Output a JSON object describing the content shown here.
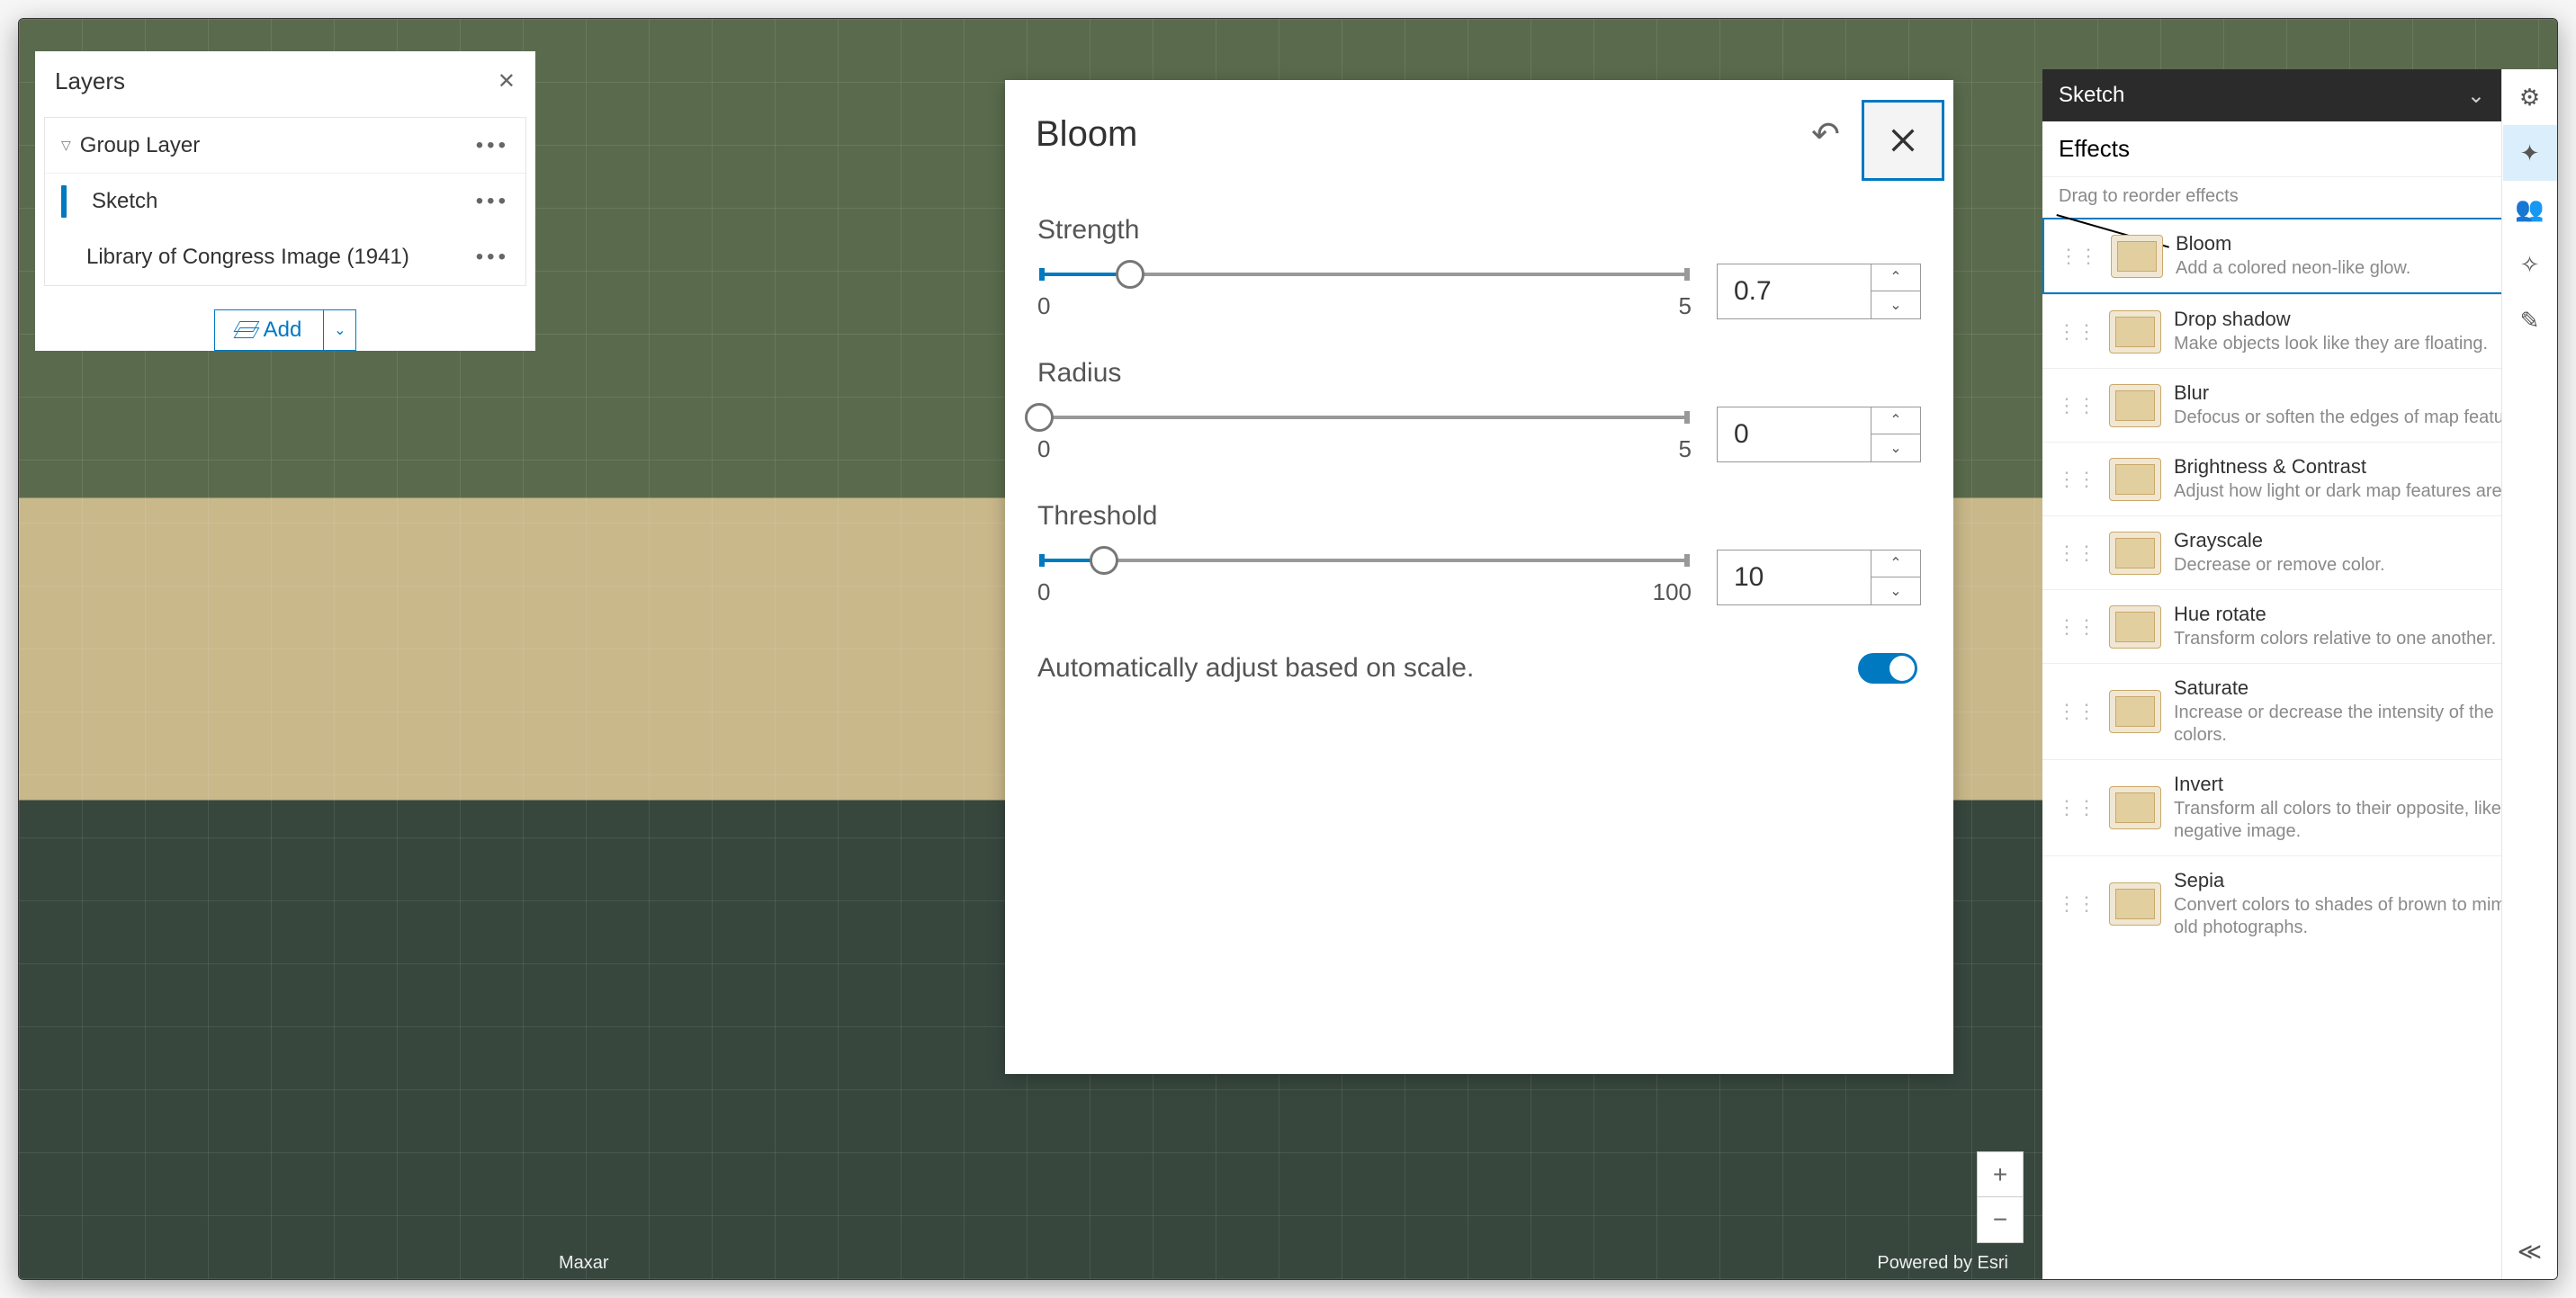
{
  "layers_panel": {
    "title": "Layers",
    "group_label": "Group Layer",
    "items": [
      {
        "name": "Sketch",
        "selected": true
      },
      {
        "name": "Library of Congress Image (1941)",
        "selected": false
      }
    ],
    "add_label": "Add"
  },
  "map": {
    "attrib_left": "Maxar",
    "attrib_right": "Powered by Esri"
  },
  "bloom_dialog": {
    "title": "Bloom",
    "controls": [
      {
        "label": "Strength",
        "min": "0",
        "max": "5",
        "value": "0.7",
        "pct": 14
      },
      {
        "label": "Radius",
        "min": "0",
        "max": "5",
        "value": "0",
        "pct": 0
      },
      {
        "label": "Threshold",
        "min": "0",
        "max": "100",
        "value": "10",
        "pct": 10
      }
    ],
    "auto_label": "Automatically adjust based on scale.",
    "auto_on": true
  },
  "sketch_bar": {
    "title": "Sketch"
  },
  "effects_panel": {
    "title": "Effects",
    "hint": "Drag to reorder effects",
    "items": [
      {
        "name": "Bloom",
        "desc": "Add a colored neon-like glow.",
        "on": true,
        "selected": true
      },
      {
        "name": "Drop shadow",
        "desc": "Make objects look like they are floating.",
        "on": false
      },
      {
        "name": "Blur",
        "desc": "Defocus or soften the edges of map features.",
        "on": false
      },
      {
        "name": "Brightness & Contrast",
        "desc": "Adjust how light or dark map features are.",
        "on": false
      },
      {
        "name": "Grayscale",
        "desc": "Decrease or remove color.",
        "on": false
      },
      {
        "name": "Hue rotate",
        "desc": "Transform colors relative to one another.",
        "on": false
      },
      {
        "name": "Saturate",
        "desc": "Increase or decrease the intensity of the colors.",
        "on": false
      },
      {
        "name": "Invert",
        "desc": "Transform all colors to their opposite, like a negative image.",
        "on": false
      },
      {
        "name": "Sepia",
        "desc": "Convert colors to shades of brown to mimic old photographs.",
        "on": false
      }
    ]
  }
}
